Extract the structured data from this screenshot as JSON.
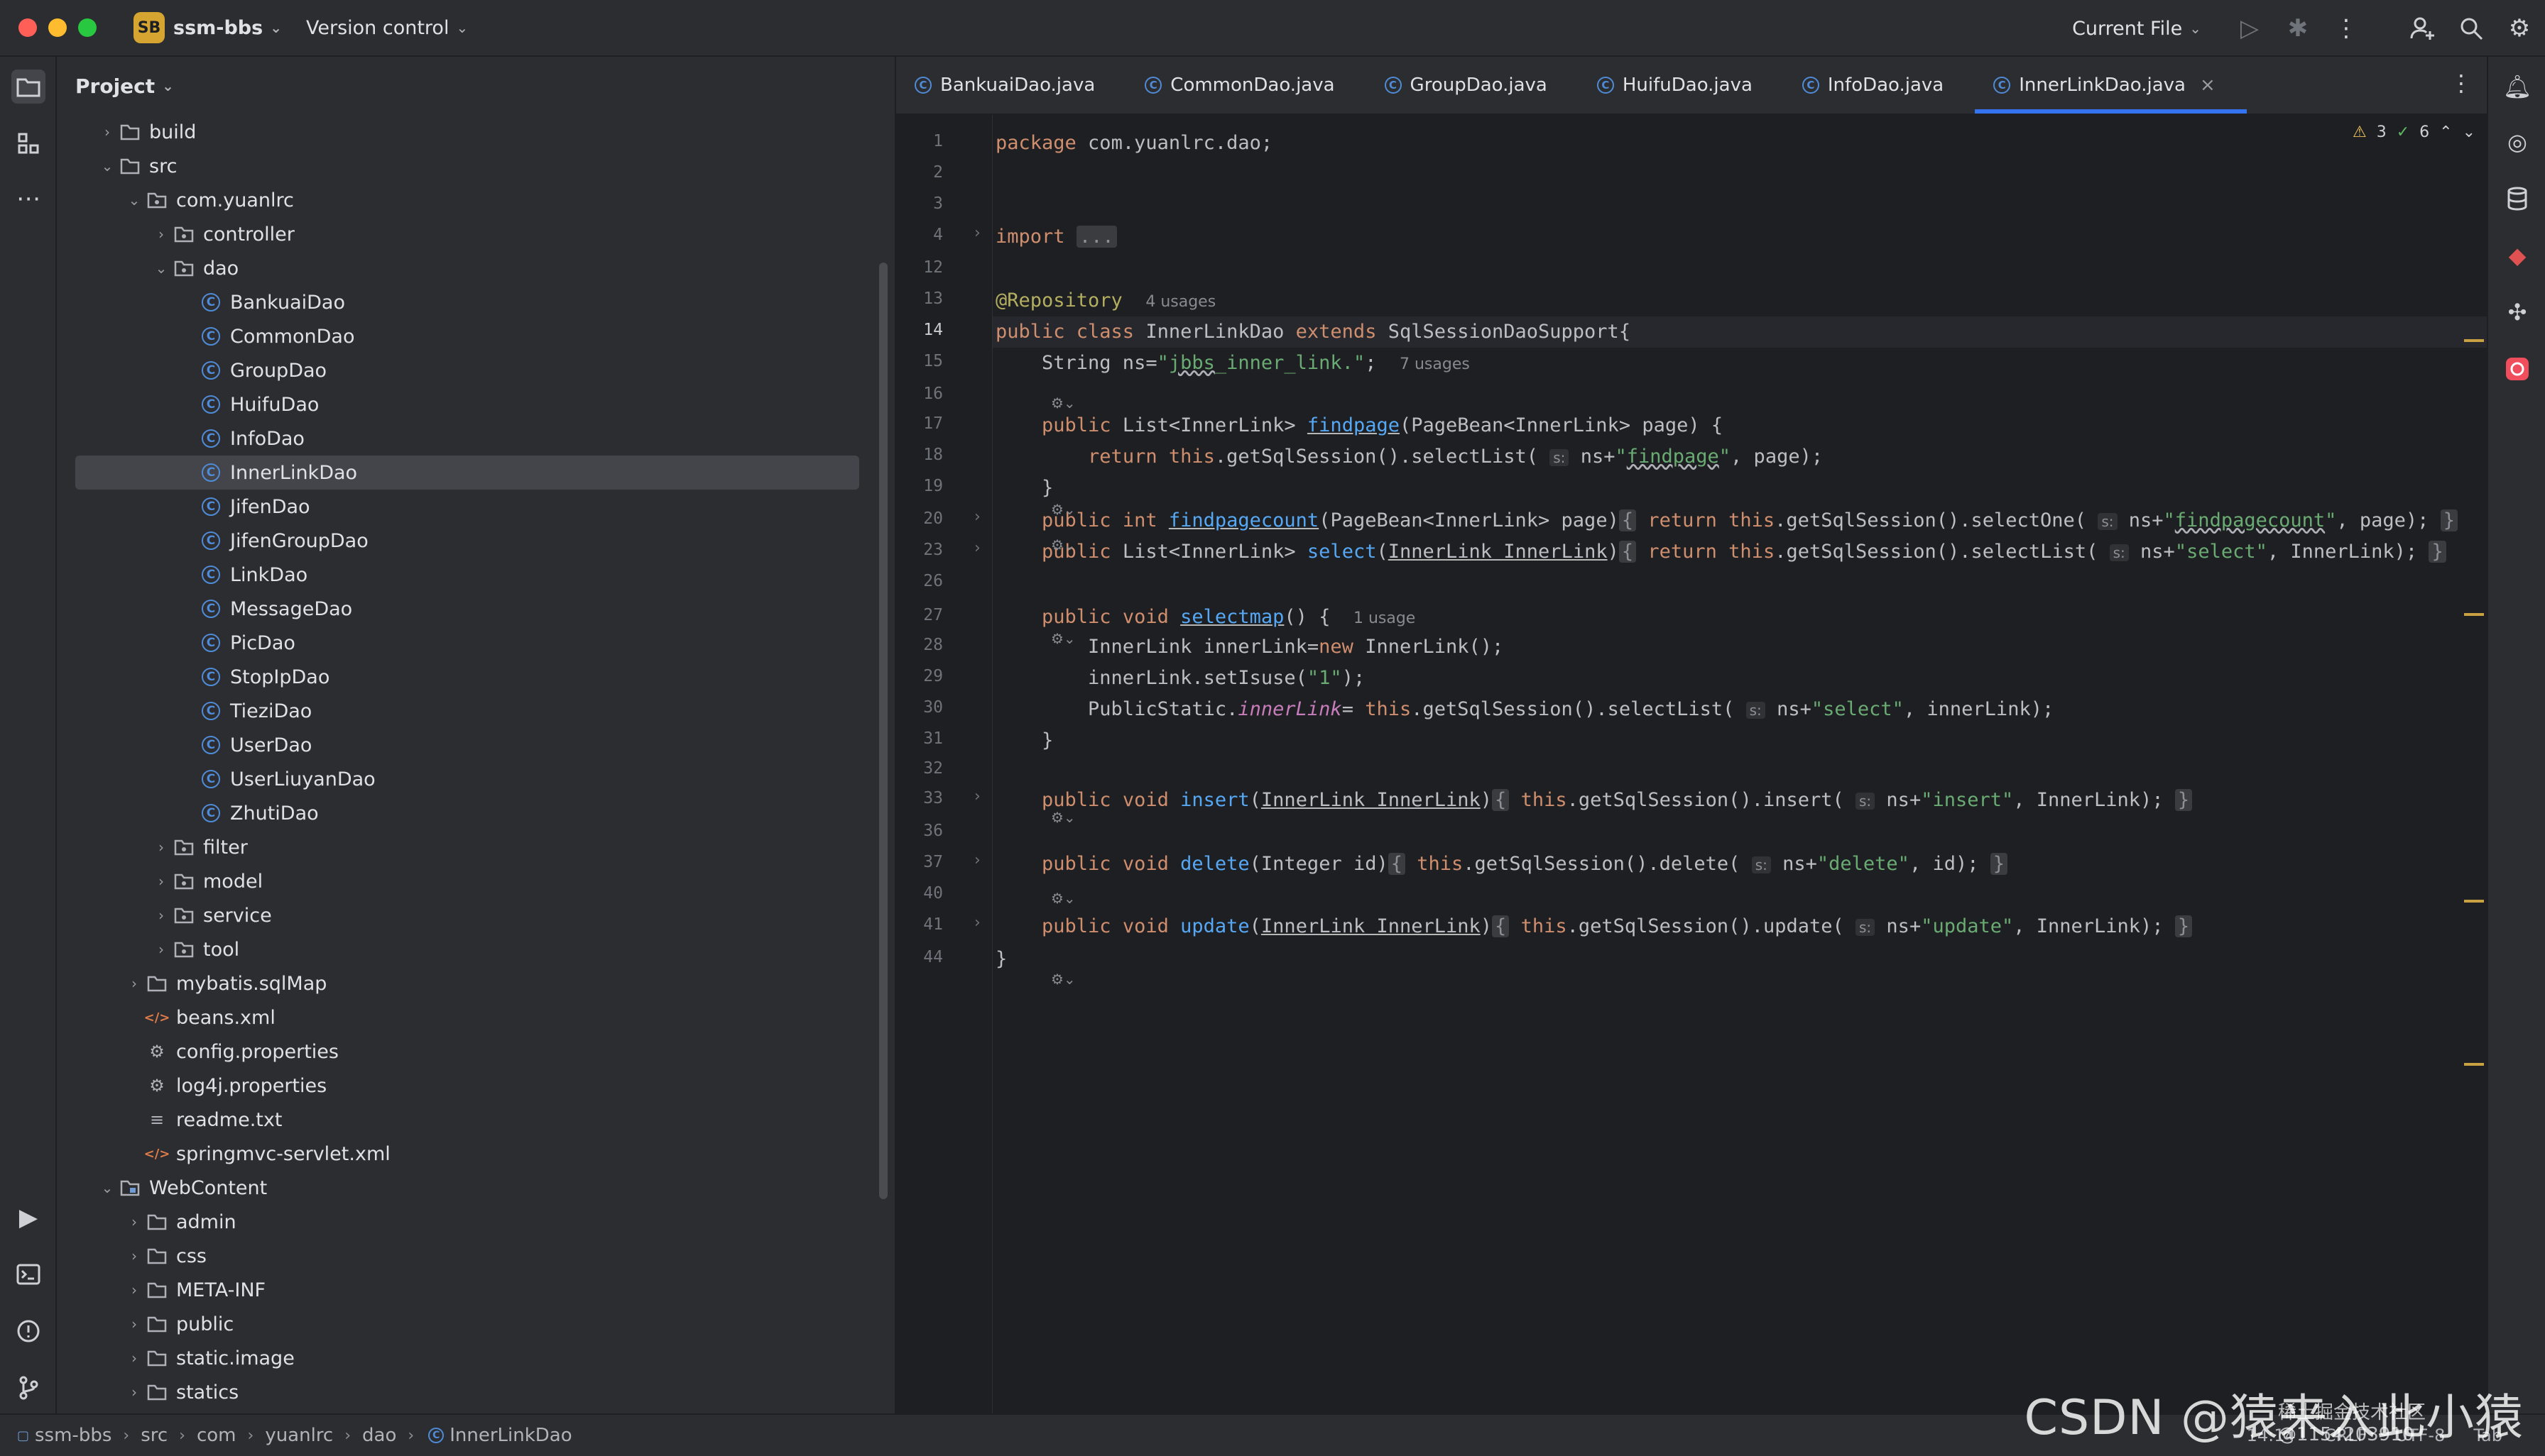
{
  "titlebar": {
    "project_badge": "SB",
    "project_name": "ssm-bbs",
    "vcs": "Version control",
    "run_config": "Current File"
  },
  "project_panel": {
    "title": "Project",
    "tree": [
      {
        "label": "build",
        "type": "folder",
        "depth": 1,
        "arrow": "›"
      },
      {
        "label": "src",
        "type": "folder",
        "depth": 1,
        "arrow": "⌄"
      },
      {
        "label": "com.yuanlrc",
        "type": "package",
        "depth": 2,
        "arrow": "⌄"
      },
      {
        "label": "controller",
        "type": "package",
        "depth": 3,
        "arrow": "›"
      },
      {
        "label": "dao",
        "type": "package",
        "depth": 3,
        "arrow": "⌄"
      },
      {
        "label": "BankuaiDao",
        "type": "class",
        "depth": 4,
        "arrow": ""
      },
      {
        "label": "CommonDao",
        "type": "class",
        "depth": 4,
        "arrow": ""
      },
      {
        "label": "GroupDao",
        "type": "class",
        "depth": 4,
        "arrow": ""
      },
      {
        "label": "HuifuDao",
        "type": "class",
        "depth": 4,
        "arrow": ""
      },
      {
        "label": "InfoDao",
        "type": "class",
        "depth": 4,
        "arrow": ""
      },
      {
        "label": "InnerLinkDao",
        "type": "class",
        "depth": 4,
        "arrow": "",
        "selected": true
      },
      {
        "label": "JifenDao",
        "type": "class",
        "depth": 4,
        "arrow": ""
      },
      {
        "label": "JifenGroupDao",
        "type": "class",
        "depth": 4,
        "arrow": ""
      },
      {
        "label": "LinkDao",
        "type": "class",
        "depth": 4,
        "arrow": ""
      },
      {
        "label": "MessageDao",
        "type": "class",
        "depth": 4,
        "arrow": ""
      },
      {
        "label": "PicDao",
        "type": "class",
        "depth": 4,
        "arrow": ""
      },
      {
        "label": "StopIpDao",
        "type": "class",
        "depth": 4,
        "arrow": ""
      },
      {
        "label": "TieziDao",
        "type": "class",
        "depth": 4,
        "arrow": ""
      },
      {
        "label": "UserDao",
        "type": "class",
        "depth": 4,
        "arrow": ""
      },
      {
        "label": "UserLiuyanDao",
        "type": "class",
        "depth": 4,
        "arrow": ""
      },
      {
        "label": "ZhutiDao",
        "type": "class",
        "depth": 4,
        "arrow": ""
      },
      {
        "label": "filter",
        "type": "package",
        "depth": 3,
        "arrow": "›"
      },
      {
        "label": "model",
        "type": "package",
        "depth": 3,
        "arrow": "›"
      },
      {
        "label": "service",
        "type": "package",
        "depth": 3,
        "arrow": "›"
      },
      {
        "label": "tool",
        "type": "package",
        "depth": 3,
        "arrow": "›"
      },
      {
        "label": "mybatis.sqlMap",
        "type": "folder",
        "depth": 2,
        "arrow": "›"
      },
      {
        "label": "beans.xml",
        "type": "xml",
        "depth": 2,
        "arrow": ""
      },
      {
        "label": "config.properties",
        "type": "props",
        "depth": 2,
        "arrow": ""
      },
      {
        "label": "log4j.properties",
        "type": "props",
        "depth": 2,
        "arrow": ""
      },
      {
        "label": "readme.txt",
        "type": "text",
        "depth": 2,
        "arrow": ""
      },
      {
        "label": "springmvc-servlet.xml",
        "type": "xml",
        "depth": 2,
        "arrow": ""
      },
      {
        "label": "WebContent",
        "type": "webfolder",
        "depth": 1,
        "arrow": "⌄"
      },
      {
        "label": "admin",
        "type": "folder",
        "depth": 2,
        "arrow": "›"
      },
      {
        "label": "css",
        "type": "folder",
        "depth": 2,
        "arrow": "›"
      },
      {
        "label": "META-INF",
        "type": "folder",
        "depth": 2,
        "arrow": "›"
      },
      {
        "label": "public",
        "type": "folder",
        "depth": 2,
        "arrow": "›"
      },
      {
        "label": "static.image",
        "type": "folder",
        "depth": 2,
        "arrow": "›"
      },
      {
        "label": "statics",
        "type": "folder",
        "depth": 2,
        "arrow": "›"
      }
    ]
  },
  "tabs": [
    {
      "label": "BankuaiDao.java",
      "active": false
    },
    {
      "label": "CommonDao.java",
      "active": false
    },
    {
      "label": "GroupDao.java",
      "active": false
    },
    {
      "label": "HuifuDao.java",
      "active": false
    },
    {
      "label": "InfoDao.java",
      "active": false
    },
    {
      "label": "InnerLinkDao.java",
      "active": true
    }
  ],
  "inspections": {
    "warnings": "3",
    "ok": "6"
  },
  "editor": {
    "current_line": "14",
    "lines": [
      {
        "n": "1",
        "html": "<span class='kw'>package</span> com.yuanlrc.dao;"
      },
      {
        "n": "2",
        "html": ""
      },
      {
        "n": "3",
        "html": ""
      },
      {
        "n": "4",
        "html": "<span class='kw'>import</span> <span class='fb'>...</span>",
        "fold": "›"
      },
      {
        "n": "12",
        "html": ""
      },
      {
        "n": "13",
        "html": "<span class='ann'>@Repository</span>  <span class='hint'>4 usages</span>"
      },
      {
        "n": "14",
        "html": "<span class='kw'>public class</span> InnerLinkDao <span class='kw'>extends</span> SqlSessionDaoSupport{"
      },
      {
        "n": "15",
        "html": "    String ns=<span class='str'>\"<span class='uls'>jbbs</span>_inner_link.\"</span>;  <span class='hint'>7 usages</span>"
      },
      {
        "n": "16",
        "html": ""
      },
      {
        "n": "17",
        "html": "    <span class='kw'>public</span> List&lt;InnerLink&gt; <span class='meth ul'>findpage</span>(PageBean&lt;InnerLink&gt; page) {"
      },
      {
        "n": "18",
        "html": "        <span class='kw'>return this</span>.getSqlSession().selectList( <span class='inl'>s:</span> ns+<span class='str'>\"<span class='uls'>findpage</span>\"</span>, page);"
      },
      {
        "n": "19",
        "html": "    }"
      },
      {
        "n": "20",
        "html": "    <span class='kw'>public int</span> <span class='meth ul'>findpagecount</span>(PageBean&lt;InnerLink&gt; page)<span class='fb'>{</span> <span class='kw'>return this</span>.getSqlSession().selectOne( <span class='inl'>s:</span> ns+<span class='str'>\"<span class='uls'>findpagecount</span>\"</span>, page); <span class='fb'>}</span>",
        "fold": "›"
      },
      {
        "n": "23",
        "html": "    <span class='kw'>public</span> List&lt;InnerLink&gt; <span class='meth'>select</span>(<span class='ul'>InnerLink InnerLink</span>)<span class='fb'>{</span> <span class='kw'>return this</span>.getSqlSession().selectList( <span class='inl'>s:</span> ns+<span class='str'>\"select\"</span>, InnerLink); <span class='fb'>}</span>",
        "fold": "›"
      },
      {
        "n": "26",
        "html": ""
      },
      {
        "n": "27",
        "html": "    <span class='kw'>public void</span> <span class='meth ul'>selectmap</span>() {  <span class='hint'>1 usage</span>"
      },
      {
        "n": "28",
        "html": "        InnerLink innerLink=<span class='kw'>new</span> InnerLink();"
      },
      {
        "n": "29",
        "html": "        innerLink.setIsuse(<span class='str'>\"1\"</span>);"
      },
      {
        "n": "30",
        "html": "        PublicStatic.<span class='fld'>innerLink</span>= <span class='kw'>this</span>.getSqlSession().selectList( <span class='inl'>s:</span> ns+<span class='str'>\"select\"</span>, innerLink);"
      },
      {
        "n": "31",
        "html": "    }"
      },
      {
        "n": "32",
        "html": ""
      },
      {
        "n": "33",
        "html": "    <span class='kw'>public void</span> <span class='meth'>insert</span>(<span class='ul'>InnerLink InnerLink</span>)<span class='fb'>{</span> <span class='kw'>this</span>.getSqlSession().insert( <span class='inl'>s:</span> ns+<span class='str'>\"insert\"</span>, InnerLink); <span class='fb'>}</span>",
        "fold": "›"
      },
      {
        "n": "36",
        "html": ""
      },
      {
        "n": "37",
        "html": "    <span class='kw'>public void</span> <span class='meth'>delete</span>(Integer id)<span class='fb'>{</span> <span class='kw'>this</span>.getSqlSession().delete( <span class='inl'>s:</span> ns+<span class='str'>\"delete\"</span>, id); <span class='fb'>}</span>",
        "fold": "›"
      },
      {
        "n": "40",
        "html": ""
      },
      {
        "n": "41",
        "html": "    <span class='kw'>public void</span> <span class='meth'>update</span>(<span class='ul'>InnerLink InnerLink</span>)<span class='fb'>{</span> <span class='kw'>this</span>.getSqlSession().update( <span class='inl'>s:</span> ns+<span class='str'>\"update\"</span>, InnerLink); <span class='fb'>}</span>",
        "fold": "›"
      },
      {
        "n": "44",
        "html": "}"
      }
    ]
  },
  "breadcrumb": [
    "ssm-bbs",
    "src",
    "com",
    "yuanlrc",
    "dao",
    "InnerLinkDao"
  ],
  "status": {
    "position": "14:14",
    "line_sep": "CRLF",
    "encoding": "UTF-8",
    "indent": "Tab"
  },
  "watermark": "CSDN @猿来入此小猿",
  "watermark_small": "稀土掘金技术社区 @1154203910"
}
